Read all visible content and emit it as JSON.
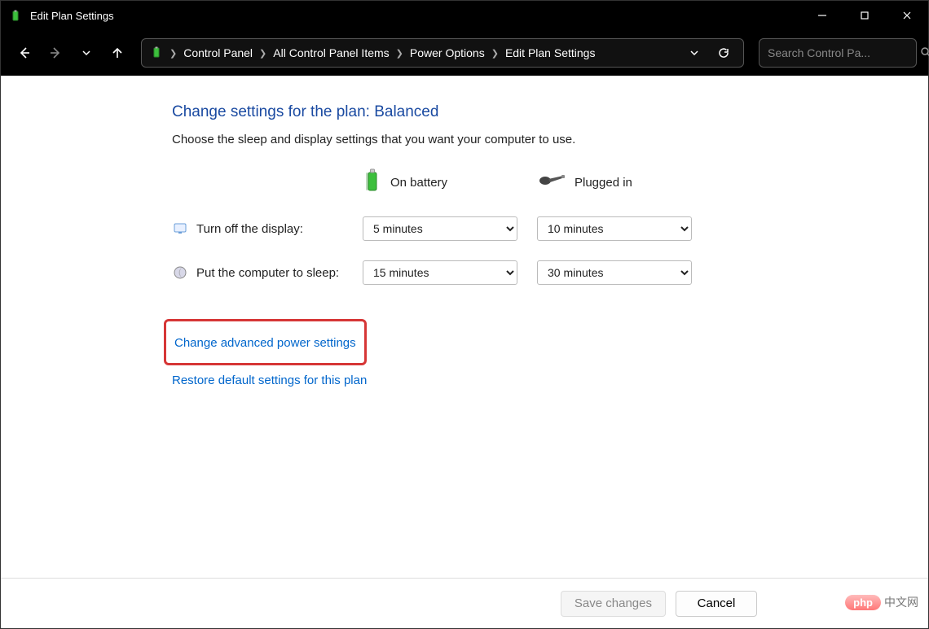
{
  "window": {
    "title": "Edit Plan Settings"
  },
  "breadcrumb": {
    "items": [
      "Control Panel",
      "All Control Panel Items",
      "Power Options",
      "Edit Plan Settings"
    ]
  },
  "search": {
    "placeholder": "Search Control Pa..."
  },
  "page": {
    "heading": "Change settings for the plan: Balanced",
    "description": "Choose the sleep and display settings that you want your computer to use.",
    "columns": {
      "battery": "On battery",
      "plugged": "Plugged in"
    },
    "rows": {
      "display_label": "Turn off the display:",
      "sleep_label": "Put the computer to sleep:"
    },
    "values": {
      "display_battery": "5 minutes",
      "display_plugged": "10 minutes",
      "sleep_battery": "15 minutes",
      "sleep_plugged": "30 minutes"
    },
    "links": {
      "advanced": "Change advanced power settings",
      "restore": "Restore default settings for this plan"
    }
  },
  "footer": {
    "save": "Save changes",
    "cancel": "Cancel"
  },
  "watermark": {
    "badge": "php",
    "text": "中文网"
  }
}
